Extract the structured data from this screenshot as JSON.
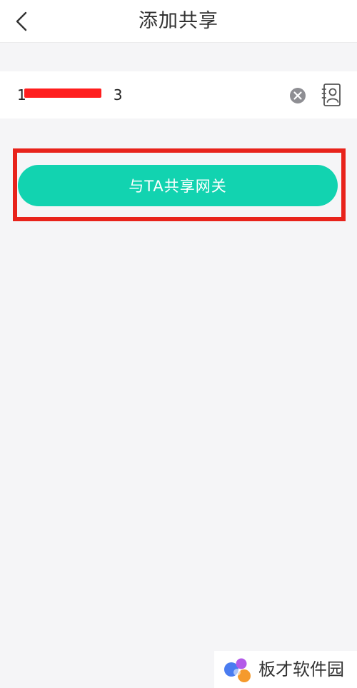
{
  "header": {
    "title": "添加共享",
    "back_icon": "chevron-left-icon"
  },
  "share_form": {
    "phone_value": "1",
    "phone_value_tail": "3",
    "redaction_color": "#ff1e1e",
    "clear_icon": "clear-circle-icon",
    "contacts_icon": "contact-book-icon"
  },
  "primary_action": {
    "label": "与TA共享网关",
    "button_color": "#12d3b0",
    "highlight_color": "#e8231b"
  },
  "watermark": {
    "text": "板才软件园"
  }
}
